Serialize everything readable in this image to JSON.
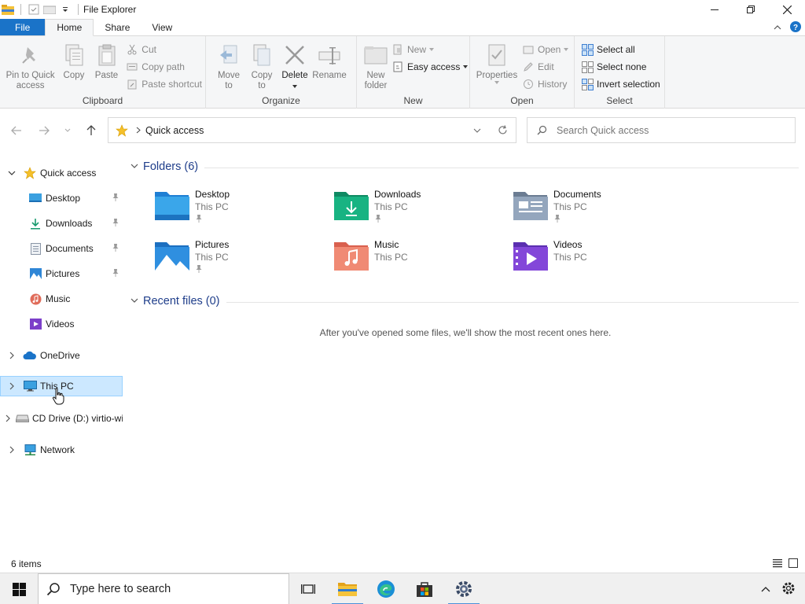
{
  "window": {
    "title": "File Explorer"
  },
  "ribbon": {
    "tabs": [
      {
        "label": "File"
      },
      {
        "label": "Home"
      },
      {
        "label": "Share"
      },
      {
        "label": "View"
      }
    ],
    "clipboard": {
      "label": "Clipboard",
      "pin_label": "Pin to Quick access",
      "pin_l1": "Pin to Quick",
      "pin_l2": "access",
      "copy": "Copy",
      "paste": "Paste",
      "cut": "Cut",
      "copy_path": "Copy path",
      "paste_shortcut": "Paste shortcut"
    },
    "organize": {
      "label": "Organize",
      "move_to_l1": "Move",
      "move_to_l2": "to",
      "copy_to_l1": "Copy",
      "copy_to_l2": "to",
      "delete": "Delete",
      "rename": "Rename"
    },
    "new": {
      "label": "New",
      "new_folder_l1": "New",
      "new_folder_l2": "folder",
      "new_item": "New",
      "easy_access": "Easy access"
    },
    "open": {
      "label": "Open",
      "properties": "Properties",
      "open": "Open",
      "edit": "Edit",
      "history": "History"
    },
    "select": {
      "label": "Select",
      "select_all": "Select all",
      "select_none": "Select none",
      "invert": "Invert selection"
    }
  },
  "address": {
    "crumb": "Quick access",
    "search_placeholder": "Search Quick access"
  },
  "nav": {
    "quick_access": "Quick access",
    "items": [
      {
        "label": "Desktop",
        "pinned": true
      },
      {
        "label": "Downloads",
        "pinned": true
      },
      {
        "label": "Documents",
        "pinned": true
      },
      {
        "label": "Pictures",
        "pinned": true
      },
      {
        "label": "Music",
        "pinned": false
      },
      {
        "label": "Videos",
        "pinned": false
      }
    ],
    "onedrive": "OneDrive",
    "this_pc": "This PC",
    "cd_drive": "CD Drive (D:) virtio-win",
    "network": "Network"
  },
  "content": {
    "folders_header": "Folders (6)",
    "folders": [
      {
        "name": "Desktop",
        "location": "This PC",
        "pinned": true
      },
      {
        "name": "Downloads",
        "location": "This PC",
        "pinned": true
      },
      {
        "name": "Documents",
        "location": "This PC",
        "pinned": true
      },
      {
        "name": "Pictures",
        "location": "This PC",
        "pinned": true
      },
      {
        "name": "Music",
        "location": "This PC",
        "pinned": false
      },
      {
        "name": "Videos",
        "location": "This PC",
        "pinned": false
      }
    ],
    "recent_header": "Recent files (0)",
    "recent_empty": "After you've opened some files, we'll show the most recent ones here."
  },
  "status": {
    "item_count": "6 items"
  },
  "taskbar": {
    "search_text": "Type here to search"
  },
  "colors": {
    "accent": "#1a73c8",
    "selection": "#cce8ff",
    "folder_yellow": "#f3c13a"
  }
}
